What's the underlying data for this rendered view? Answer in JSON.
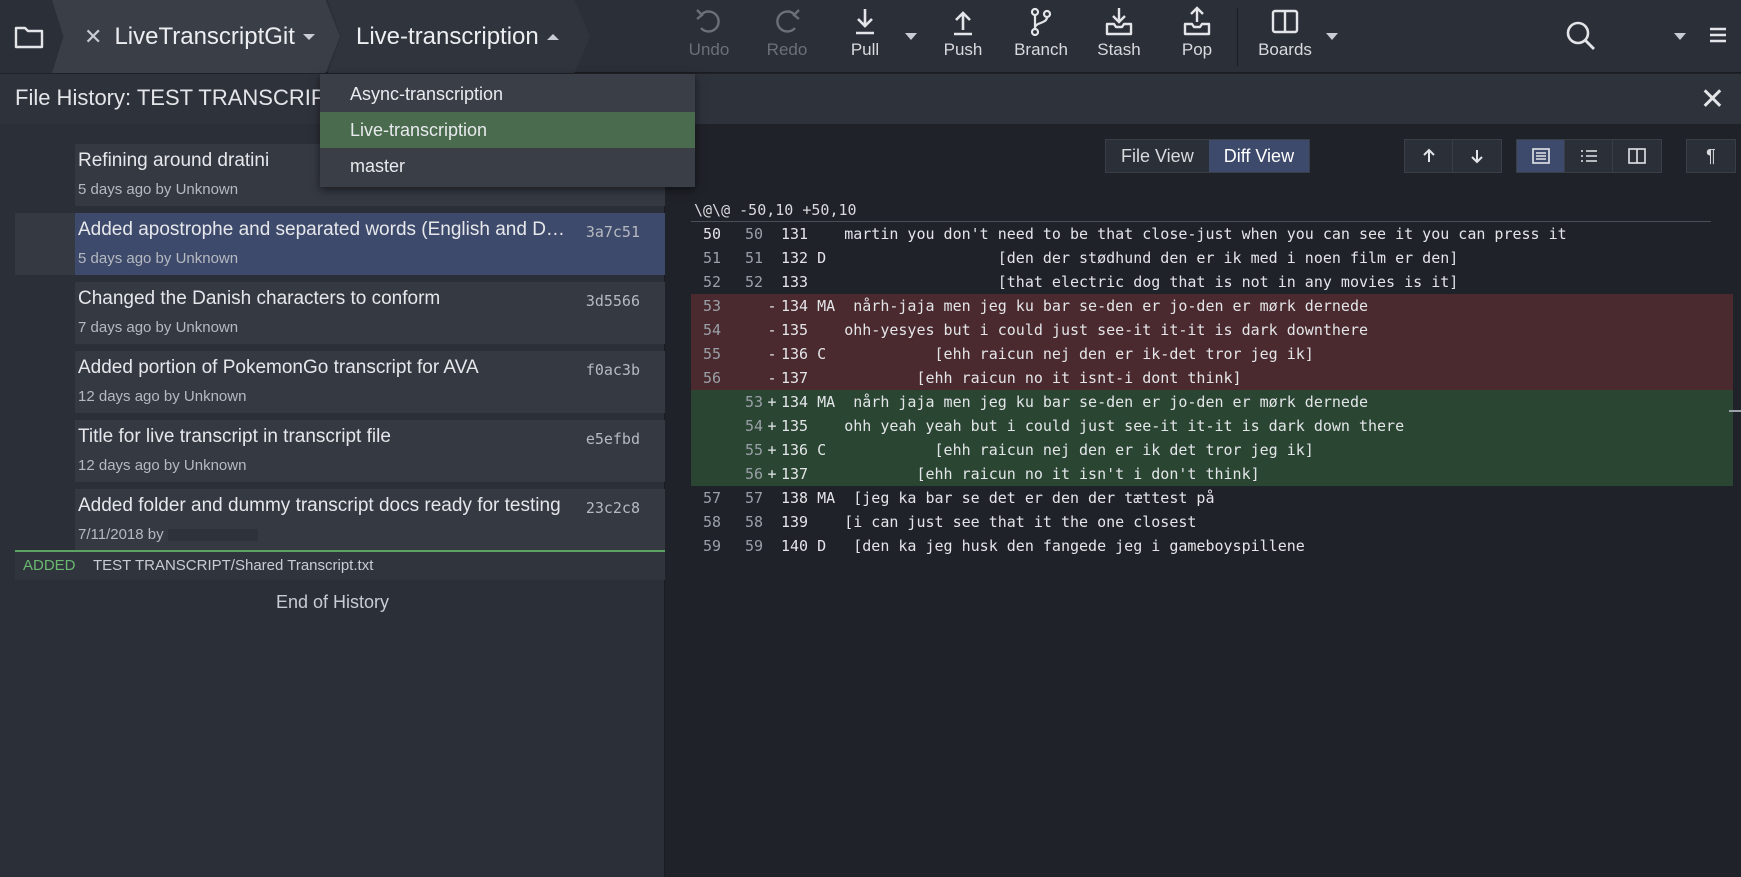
{
  "toolbar": {
    "repo_name": "LiveTranscriptGit",
    "branch_name": "Live-transcription",
    "actions": {
      "undo": "Undo",
      "redo": "Redo",
      "pull": "Pull",
      "push": "Push",
      "branch": "Branch",
      "stash": "Stash",
      "pop": "Pop",
      "boards": "Boards"
    }
  },
  "branch_dropdown": {
    "items": [
      "Async-transcription",
      "Live-transcription",
      "master"
    ],
    "selected": "Live-transcription"
  },
  "file_history": {
    "title": "File History: TEST TRANSCRIPT/Shared Transcript.txt",
    "commits": [
      {
        "message": "Refining around dratini",
        "meta": "5 days ago by Unknown",
        "sha": ""
      },
      {
        "message": "Added apostrophe and separated words (English and Danish)",
        "meta": "5 days ago by Unknown",
        "sha": "3a7c51"
      },
      {
        "message": "Changed the Danish characters to conform",
        "meta": "7 days ago by Unknown",
        "sha": "3d5566"
      },
      {
        "message": "Added portion of PokemonGo transcript for AVA",
        "meta": "12 days ago by Unknown",
        "sha": "f0ac3b"
      },
      {
        "message": "Title for live transcript in transcript file",
        "meta": "12 days ago by Unknown",
        "sha": "e5efbd"
      },
      {
        "message": "Added folder and dummy transcript docs ready for testing",
        "meta": "7/11/2018 by",
        "sha": "23c2c8"
      }
    ],
    "file_status": "ADDED",
    "file_path": "TEST TRANSCRIPT/Shared Transcript.txt",
    "end_label": "End of History"
  },
  "diff": {
    "view_file": "File View",
    "view_diff": "Diff View",
    "hunk_header": "\\@\\@ -50,10 +50,10",
    "lines": [
      {
        "old": "50",
        "new": "50",
        "sign": "",
        "type": "ctx",
        "text": "131    martin you don't need to be that close-just when you can see it you can press it"
      },
      {
        "old": "51",
        "new": "51",
        "sign": "",
        "type": "ctx",
        "text": "132 D                   [den der stødhund den er ik med i noen film er den]"
      },
      {
        "old": "52",
        "new": "52",
        "sign": "",
        "type": "ctx",
        "text": "133                     [that electric dog that is not in any movies is it]"
      },
      {
        "old": "53",
        "new": "",
        "sign": "-",
        "type": "del",
        "text": "134 MA  nårh-jaja men jeg ku bar se-den er jo-den er mørk dernede"
      },
      {
        "old": "54",
        "new": "",
        "sign": "-",
        "type": "del",
        "text": "135    ohh-yesyes but i could just see-it it-it is dark downthere"
      },
      {
        "old": "55",
        "new": "",
        "sign": "-",
        "type": "del",
        "text": "136 C            [ehh raicun nej den er ik-det tror jeg ik]"
      },
      {
        "old": "56",
        "new": "",
        "sign": "-",
        "type": "del",
        "text": "137            [ehh raicun no it isnt-i dont think]"
      },
      {
        "old": "",
        "new": "53",
        "sign": "+",
        "type": "add",
        "text": "134 MA  nårh jaja men jeg ku bar se-den er jo-den er mørk dernede"
      },
      {
        "old": "",
        "new": "54",
        "sign": "+",
        "type": "add",
        "text": "135    ohh yeah yeah but i could just see-it it-it is dark down there"
      },
      {
        "old": "",
        "new": "55",
        "sign": "+",
        "type": "add",
        "text": "136 C            [ehh raicun nej den er ik det tror jeg ik]"
      },
      {
        "old": "",
        "new": "56",
        "sign": "+",
        "type": "add",
        "text": "137            [ehh raicun no it isn't i don't think]"
      },
      {
        "old": "57",
        "new": "57",
        "sign": "",
        "type": "ctx",
        "text": "138 MA  [jeg ka bar se det er den der tættest på"
      },
      {
        "old": "58",
        "new": "58",
        "sign": "",
        "type": "ctx",
        "text": "139    [i can just see that it the one closest"
      },
      {
        "old": "59",
        "new": "59",
        "sign": "",
        "type": "ctx",
        "text": "140 D   [den ka jeg husk den fangede jeg i gameboyspillene"
      }
    ]
  },
  "colors": {
    "accent_selected": "#3e4a6b",
    "added_status": "#6ab86f",
    "diff_deleted_bg": "#4a2a2e",
    "diff_added_bg": "#2a4632",
    "dropdown_active": "#4a6b4e"
  }
}
